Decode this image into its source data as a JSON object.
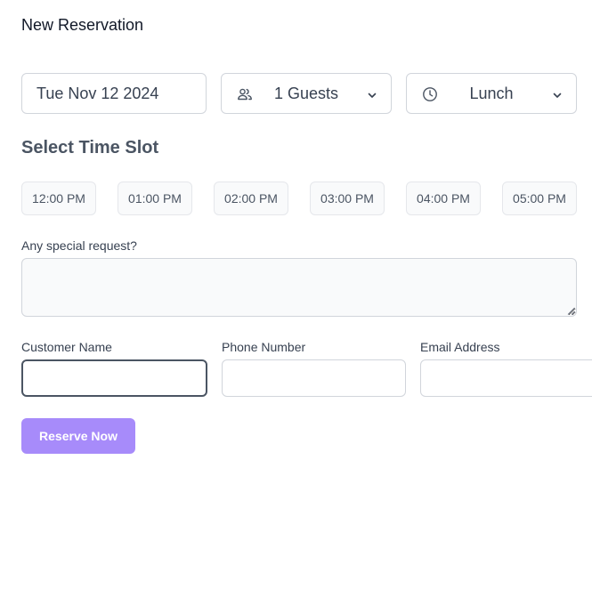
{
  "form": {
    "title": "New Reservation",
    "date_value": "Tue Nov 12 2024",
    "guests": {
      "label": "1 Guests",
      "icon": "users-icon"
    },
    "meal": {
      "label": "Lunch",
      "icon": "clock-icon"
    },
    "time_slot_title": "Select Time Slot",
    "time_slots": [
      "12:00 PM",
      "01:00 PM",
      "02:00 PM",
      "03:00 PM",
      "04:00 PM",
      "05:00 PM"
    ],
    "special_request_label": "Any special request?",
    "special_request_value": "",
    "customer_name_label": "Customer Name",
    "customer_name_value": "",
    "phone_label": "Phone Number",
    "phone_value": "",
    "email_label": "Email Address",
    "email_value": "",
    "submit_label": "Reserve Now"
  },
  "colors": {
    "accent": "#a78bfa",
    "border": "#d1d5db",
    "slot_bg": "#f9fafb",
    "focus_border": "#4b5563"
  }
}
